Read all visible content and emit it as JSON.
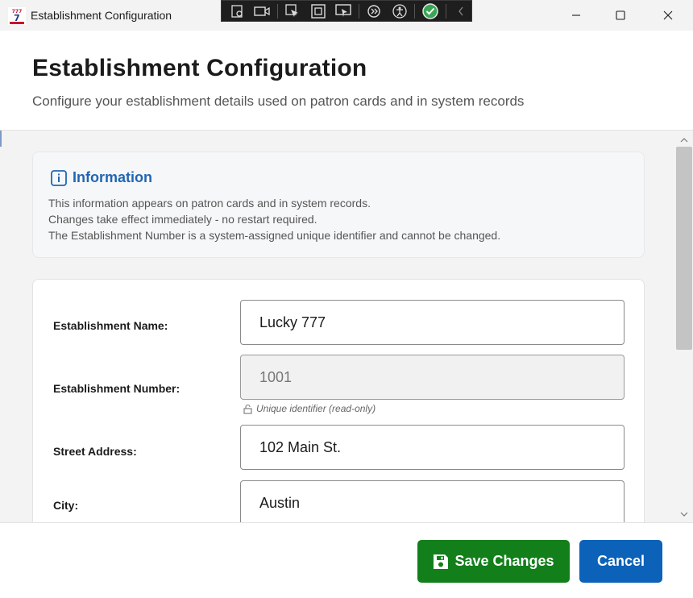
{
  "window": {
    "title": "Establishment Configuration",
    "icon": "777-app-icon"
  },
  "header": {
    "title": "Establishment Configuration",
    "subtitle": "Configure your establishment details used on patron cards and in system records"
  },
  "info": {
    "title": "Information",
    "lines": [
      "This information appears on patron cards and in system records.",
      "Changes take effect immediately - no restart required.",
      "The Establishment Number is a system-assigned unique identifier and cannot be changed."
    ]
  },
  "form": {
    "name_label": "Establishment Name:",
    "name_value": "Lucky 777",
    "number_label": "Establishment Number:",
    "number_value": "1001",
    "number_hint": "Unique identifier (read-only)",
    "street_label": "Street Address:",
    "street_value": "102 Main St.",
    "city_label": "City:",
    "city_value": "Austin"
  },
  "footer": {
    "save_label": "Save Changes",
    "cancel_label": "Cancel"
  },
  "colors": {
    "accent": "#2166b3",
    "save": "#137f1b",
    "cancel": "#0b62b8"
  }
}
